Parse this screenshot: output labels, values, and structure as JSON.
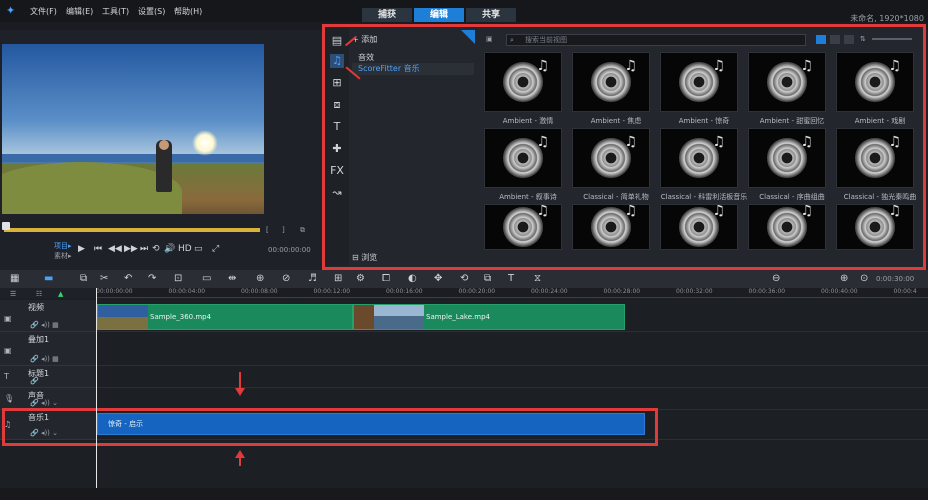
{
  "menubar": {
    "items": [
      "文件(F)",
      "编辑(E)",
      "工具(T)",
      "设置(S)",
      "帮助(H)"
    ],
    "workspace_tabs": [
      "捕获",
      "编辑",
      "共享"
    ],
    "project": "未命名, 1920*1080"
  },
  "player": {
    "mode_project": "项目▸",
    "mode_clip": "素材▸",
    "hd_label": "HD",
    "timecode": "00:00:00:00",
    "bracket_in": "[",
    "bracket_out": "]"
  },
  "library": {
    "add_label": "添加",
    "categories": [
      "音效",
      "ScoreFitter 音乐"
    ],
    "selected_category": "ScoreFitter 音乐",
    "search_placeholder": "搜索当前视图",
    "browse_label": "浏览",
    "items": [
      "Ambient - 激情",
      "Ambient - 焦虑",
      "Ambient - 惊奇",
      "Ambient - 甜蜜回忆",
      "Ambient - 戏剧",
      "Ambient - 叙事诗",
      "Classical - 简单礼物",
      "Classical - 科雷利活板音乐",
      "Classical - 序曲组曲",
      "Classical - 独光秦鸣曲",
      "",
      "",
      "",
      "",
      ""
    ]
  },
  "timeline": {
    "zoom_timecode": "0:00:30:00",
    "ruler": [
      "00:00:00:00",
      "00:00:04:00",
      "00:00:08:00",
      "00:00:12:00",
      "00:00:16:00",
      "00:00:20:00",
      "00:00:24:00",
      "00:00:28:00",
      "00:00:32:00",
      "00:00:36:00",
      "00:00:40:00",
      "00:00:4"
    ],
    "tracks": [
      {
        "name": "视频"
      },
      {
        "name": "叠加1"
      },
      {
        "name": "标题1"
      },
      {
        "name": "声音"
      },
      {
        "name": "音乐1"
      }
    ],
    "clips": [
      {
        "label": "Sample_360.mp4"
      },
      {
        "label": "Sample_Lake.mp4"
      }
    ],
    "music_clip": "惊奇 - 启示"
  },
  "colors": {
    "accent": "#1d7fd8",
    "highlight_box": "#e03a3a",
    "video_clip": "#1a8a5c",
    "music_clip": "#1565c0"
  }
}
